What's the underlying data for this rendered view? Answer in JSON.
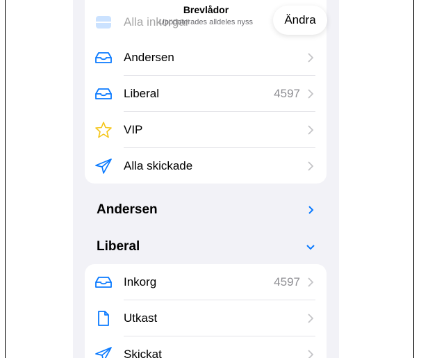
{
  "header": {
    "title": "Brevlådor",
    "subtitle": "Uppdaterades alldeles nyss",
    "edit_label": "Ändra"
  },
  "favorites": {
    "items": [
      {
        "label": "Alla inkorgar",
        "icon": "tray-stack-icon",
        "count": ""
      },
      {
        "label": "Andersen",
        "icon": "inbox-tray-icon",
        "count": ""
      },
      {
        "label": "Liberal",
        "icon": "inbox-tray-icon",
        "count": "4597"
      },
      {
        "label": "VIP",
        "icon": "star-icon",
        "count": ""
      },
      {
        "label": "Alla skickade",
        "icon": "paperplane-icon",
        "count": ""
      }
    ]
  },
  "sections": [
    {
      "title": "Andersen",
      "state": "collapsed"
    },
    {
      "title": "Liberal",
      "state": "expanded"
    }
  ],
  "liberal": {
    "items": [
      {
        "label": "Inkorg",
        "icon": "inbox-tray-icon",
        "count": "4597"
      },
      {
        "label": "Utkast",
        "icon": "document-icon",
        "count": ""
      },
      {
        "label": "Skickat",
        "icon": "paperplane-icon",
        "count": ""
      }
    ]
  },
  "colors": {
    "accent": "#0a7aff",
    "vip_star": "#f5c518",
    "background": "#f2f2f7",
    "secondary_text": "#8e8e93"
  }
}
